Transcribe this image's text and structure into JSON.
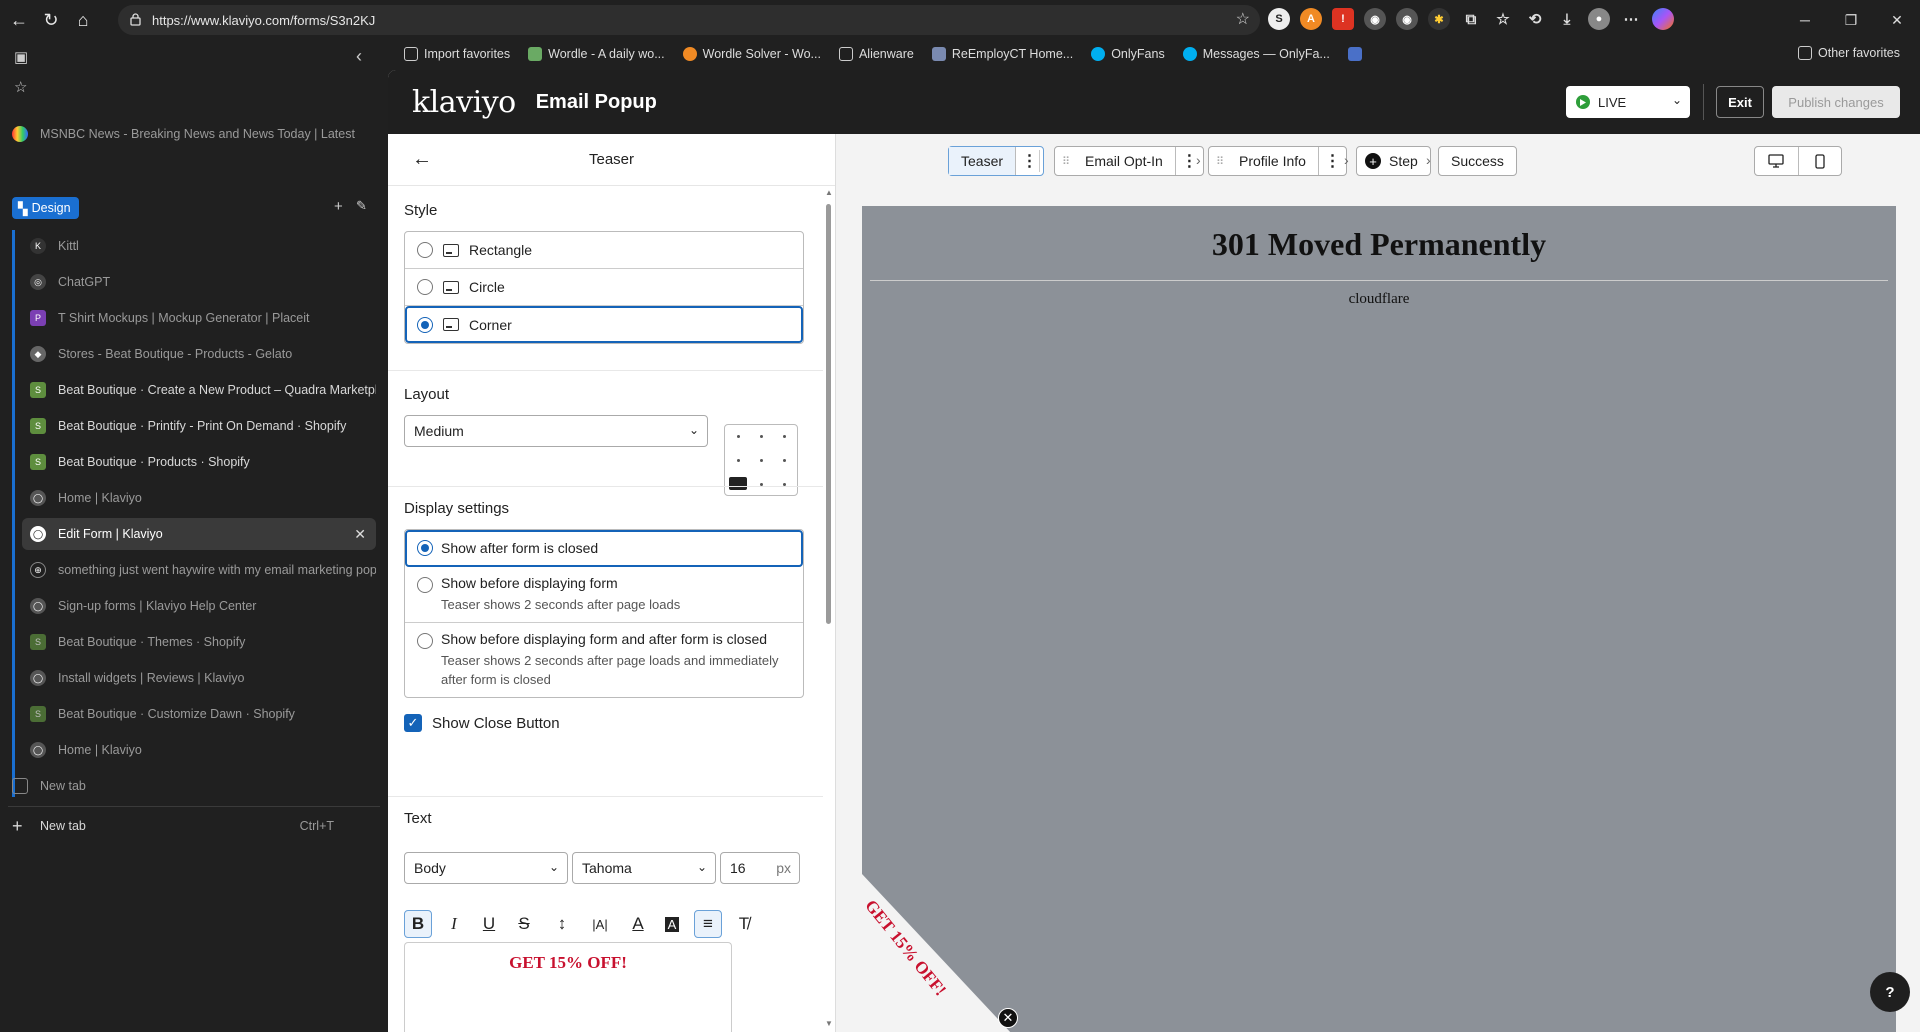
{
  "browser": {
    "url": "https://www.klaviyo.com/forms/S3n2KJ",
    "favorites": [
      "Import favorites",
      "Wordle - A daily wo...",
      "Wordle Solver - Wo...",
      "Alienware",
      "ReEmployCT Home...",
      "OnlyFans",
      "Messages — OnlyFa..."
    ],
    "other_favorites": "Other favorites"
  },
  "sidebar": {
    "pinned_tab": "MSNBC News - Breaking News and News Today | Latest News",
    "group_label": "Design",
    "tabs": [
      "Kittl",
      "ChatGPT",
      "T Shirt Mockups | Mockup Generator | Placeit",
      "Stores - Beat Boutique - Products - Gelato",
      "Beat Boutique · Create a New Product – Quadra Marketplace",
      "Beat Boutique · Printify - Print On Demand · Shopify",
      "Beat Boutique · Products · Shopify",
      "Home | Klaviyo",
      "Edit Form | Klaviyo",
      "something just went haywire with my email marketing pop",
      "Sign-up forms | Klaviyo Help Center",
      "Beat Boutique · Themes · Shopify",
      "Install widgets | Reviews | Klaviyo",
      "Beat Boutique · Customize Dawn · Shopify",
      "Home | Klaviyo"
    ],
    "new_tab_inner": "New tab",
    "new_tab": "New tab",
    "new_tab_shortcut": "Ctrl+T"
  },
  "app": {
    "logo": "klaviyo",
    "title": "Email Popup",
    "live_label": "LIVE",
    "exit_label": "Exit",
    "publish_label": "Publish changes"
  },
  "panel": {
    "title": "Teaser",
    "style_title": "Style",
    "style_options": [
      "Rectangle",
      "Circle",
      "Corner"
    ],
    "style_selected": "Corner",
    "layout_title": "Layout",
    "layout_value": "Medium",
    "display_title": "Display settings",
    "display_options": [
      {
        "label": "Show after form is closed",
        "sub": ""
      },
      {
        "label": "Show before displaying form",
        "sub": "Teaser shows 2 seconds after page loads"
      },
      {
        "label": "Show before displaying form and after form is closed",
        "sub": "Teaser shows 2 seconds after page loads and immediately after form is closed"
      }
    ],
    "show_close_label": "Show Close Button",
    "show_close_checked": true,
    "text_title": "Text",
    "text_style": "Body",
    "font": "Tahoma",
    "font_size": "16",
    "font_unit": "px",
    "editor_text": "GET 15% OFF!"
  },
  "steps": {
    "teaser": "Teaser",
    "email": "Email Opt-In",
    "profile": "Profile Info",
    "add_step": "Step",
    "success": "Success"
  },
  "preview": {
    "heading": "301 Moved Permanently",
    "server": "cloudflare",
    "teaser_text": "GET 15% OFF!"
  },
  "help_label": "?",
  "colors": {
    "accent": "#1463b8",
    "teaser_red": "#c8102e",
    "live_green": "#2e9e3a"
  }
}
